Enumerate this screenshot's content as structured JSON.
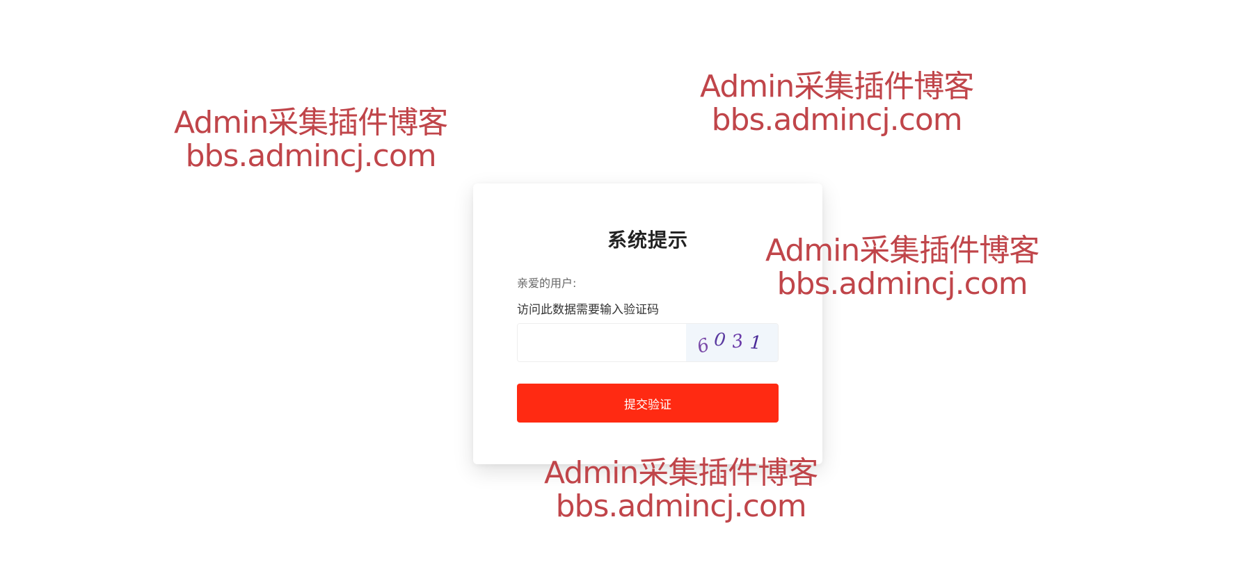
{
  "dialog": {
    "title": "系统提示",
    "greeting": "亲爱的用户:",
    "message": "访问此数据需要输入验证码",
    "captcha": {
      "input_value": "",
      "placeholder": "",
      "image_text": [
        "6",
        "0",
        "3",
        "1"
      ],
      "image_colors": [
        "#7a4aa8",
        "#5a3aa0",
        "#6a3aa8",
        "#4a2a98"
      ]
    },
    "submit_label": "提交验证"
  },
  "watermarks": [
    {
      "line1": "Admin采集插件博客",
      "line2": "bbs.admincj.com"
    },
    {
      "line1": "Admin采集插件博客",
      "line2": "bbs.admincj.com"
    },
    {
      "line1": "Admin采集插件博客",
      "line2": "bbs.admincj.com"
    },
    {
      "line1": "Admin采集插件博客",
      "line2": "bbs.admincj.com"
    }
  ],
  "colors": {
    "submit_button": "#ff2a12",
    "watermark": "#c0454a",
    "captcha_background": "#f1f6fb"
  }
}
